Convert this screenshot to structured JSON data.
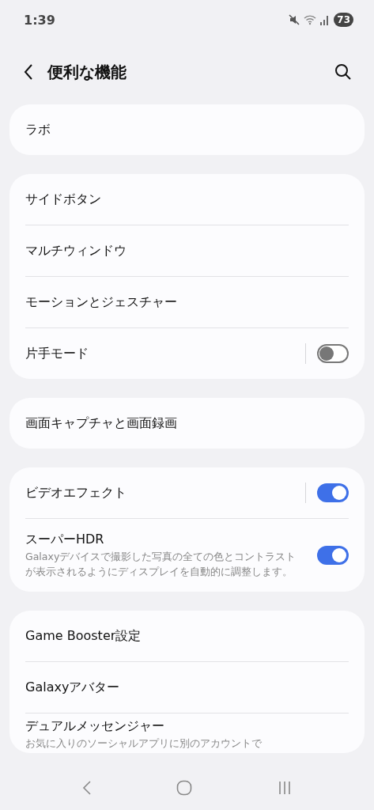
{
  "status_bar": {
    "time": "1:39",
    "battery": "73"
  },
  "header": {
    "title": "便利な機能"
  },
  "groups": [
    [
      {
        "kind": "plain",
        "title": "ラボ"
      }
    ],
    [
      {
        "kind": "plain",
        "title": "サイドボタン"
      },
      {
        "kind": "plain",
        "title": "マルチウィンドウ"
      },
      {
        "kind": "plain",
        "title": "モーションとジェスチャー"
      },
      {
        "kind": "split-switch",
        "title": "片手モード",
        "on": false
      }
    ],
    [
      {
        "kind": "plain",
        "title": "画面キャプチャと画面録画"
      }
    ],
    [
      {
        "kind": "split-switch",
        "title": "ビデオエフェクト",
        "on": true
      },
      {
        "kind": "switch",
        "title": "スーパーHDR",
        "description": "Galaxyデバイスで撮影した写真の全ての色とコントラストが表示されるようにディスプレイを自動的に調整します。",
        "on": true
      }
    ],
    [
      {
        "kind": "plain",
        "title": "Game Booster設定"
      },
      {
        "kind": "plain",
        "title": "Galaxyアバター"
      },
      {
        "kind": "plain",
        "title": "デュアルメッセンジャー",
        "description": "お気に入りのソーシャルアプリに別のアカウントで"
      }
    ]
  ]
}
